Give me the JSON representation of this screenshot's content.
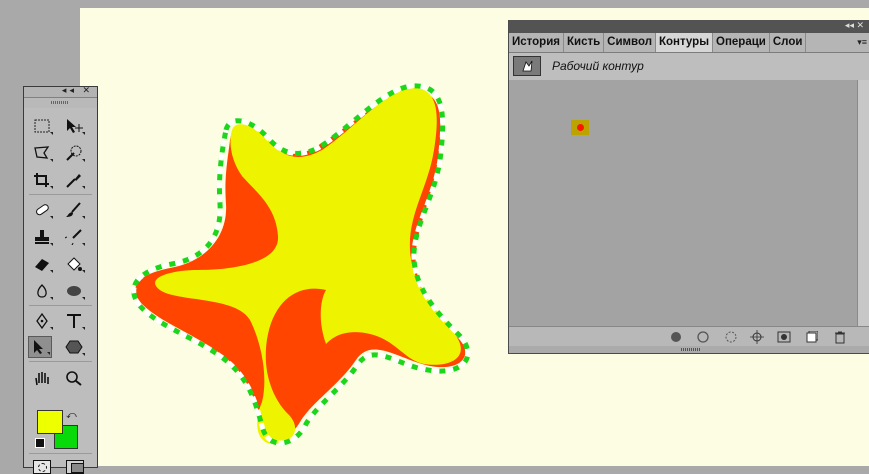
{
  "panel": {
    "tabs": [
      {
        "label": "История",
        "active": false
      },
      {
        "label": "Кисть",
        "active": false
      },
      {
        "label": "Символ",
        "active": false
      },
      {
        "label": "Контуры",
        "active": true
      },
      {
        "label": "Операци",
        "active": false
      },
      {
        "label": "Слои",
        "active": false
      }
    ],
    "path_name": "Рабочий контур"
  },
  "colors": {
    "canvas": "#fdfde4",
    "star_fill": "#eef400",
    "star_shadow": "#ff4500",
    "selection_outline": "#1bd61b",
    "foreground": "#eeff00",
    "background": "#08d908"
  },
  "icons": {
    "tools": [
      "rectangular-marquee-icon",
      "move-icon",
      "polygonal-lasso-icon",
      "quick-selection-icon",
      "crop-icon",
      "eyedropper-icon",
      "spot-healing-brush-icon",
      "brush-icon",
      "clone-stamp-icon",
      "history-brush-icon",
      "eraser-icon",
      "paint-bucket-icon",
      "blur-icon",
      "sponge-icon",
      "pen-icon",
      "type-icon",
      "path-selection-icon",
      "custom-shape-icon",
      "hand-icon",
      "zoom-icon"
    ],
    "panel_footer": [
      "fill-path-icon",
      "stroke-path-icon",
      "load-selection-icon",
      "make-work-path-icon",
      "add-mask-icon",
      "new-path-icon",
      "trash-icon"
    ]
  }
}
